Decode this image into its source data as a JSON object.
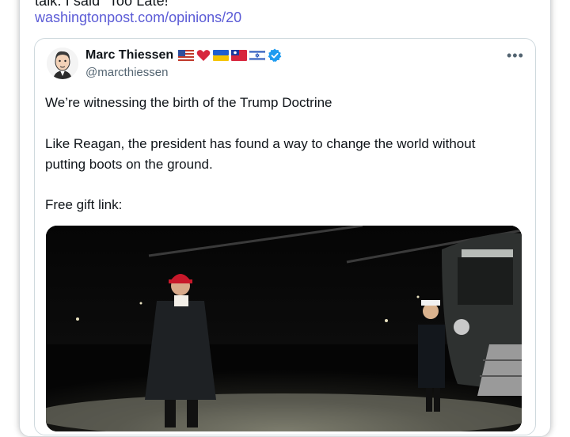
{
  "quote": {
    "text": "talk. I said \"Too Late!\"",
    "link": "washingtonpost.com/opinions/20"
  },
  "tweet": {
    "author_name": "Marc Thiessen",
    "handle": "@marcthiessen",
    "flags": [
      "us-flag-icon",
      "red-heart-icon",
      "ukraine-flag-icon",
      "taiwan-flag-icon",
      "israel-flag-icon"
    ],
    "verified_icon": "verified-badge-icon",
    "more_icon": "more-options-icon",
    "lines": [
      "We’re witnessing the birth of the Trump Doctrine",
      "Like Reagan, the president has found a way to change the world without",
      "putting boots on the ground.",
      "Free gift link:"
    ],
    "media_icon": "photo-night-helicopter"
  },
  "colors": {
    "link": "#5b5bd6",
    "verified": "#1d9bf0",
    "text": "#0f1419",
    "secondary": "#536471"
  }
}
